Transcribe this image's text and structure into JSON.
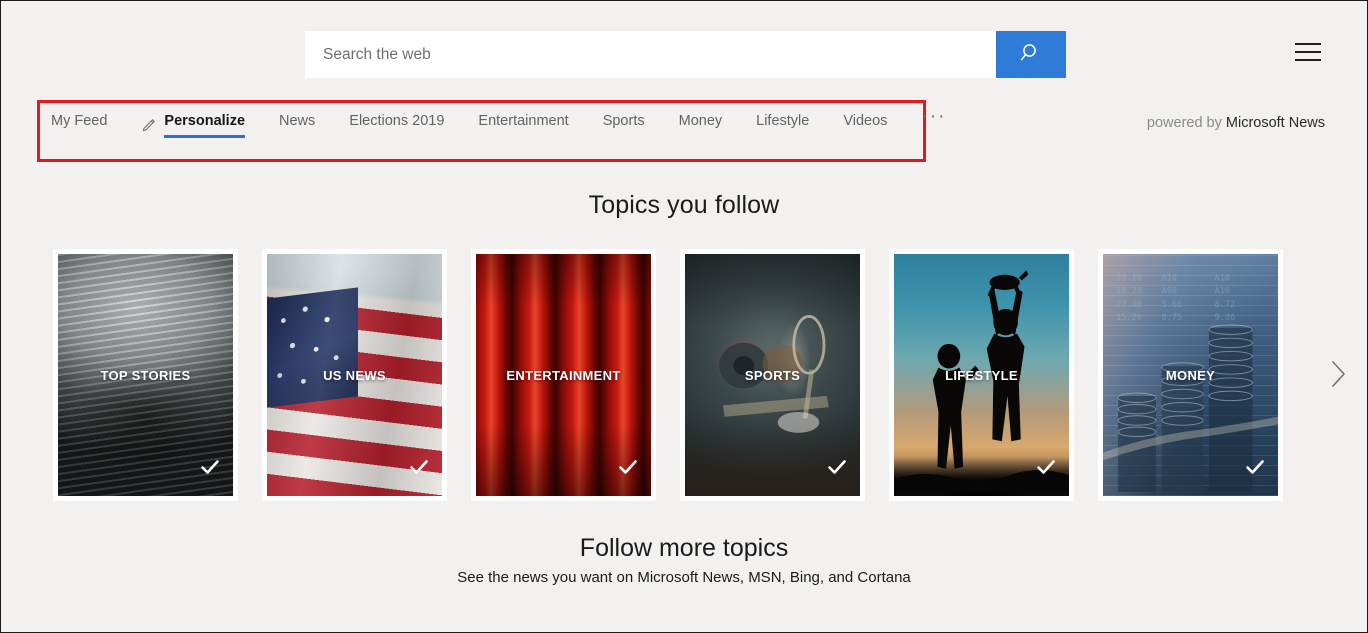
{
  "search": {
    "placeholder": "Search the web",
    "value": "",
    "button_icon": "search-icon"
  },
  "header": {
    "menu_icon": "hamburger-menu-icon"
  },
  "nav": {
    "highlight_color": "#e8171c",
    "accent_color": "#2f6fd0",
    "tabs": [
      {
        "label": "My Feed",
        "active": false
      },
      {
        "label": "Personalize",
        "active": true,
        "icon": "pencil-icon"
      },
      {
        "label": "News",
        "active": false
      },
      {
        "label": "Elections 2019",
        "active": false
      },
      {
        "label": "Entertainment",
        "active": false
      },
      {
        "label": "Sports",
        "active": false
      },
      {
        "label": "Money",
        "active": false
      },
      {
        "label": "Lifestyle",
        "active": false
      },
      {
        "label": "Videos",
        "active": false
      }
    ],
    "overflow_label": "···",
    "powered_by_prefix": "powered by",
    "powered_by_brand": "Microsoft News"
  },
  "topics": {
    "title": "Topics you follow",
    "next_icon": "chevron-right-icon",
    "cards": [
      {
        "label": "TOP STORIES",
        "followed": true,
        "image": "stacked-newspapers"
      },
      {
        "label": "US NEWS",
        "followed": true,
        "image": "american-flag"
      },
      {
        "label": "ENTERTAINMENT",
        "followed": true,
        "image": "red-theater-curtain"
      },
      {
        "label": "SPORTS",
        "followed": true,
        "image": "sports-equipment"
      },
      {
        "label": "LIFESTYLE",
        "followed": true,
        "image": "family-silhouette-sunset"
      },
      {
        "label": "MONEY",
        "followed": true,
        "image": "coin-stacks-market-data"
      }
    ]
  },
  "follow_more": {
    "title": "Follow more topics",
    "subtitle": "See the news you want on Microsoft News, MSN, Bing, and Cortana"
  }
}
